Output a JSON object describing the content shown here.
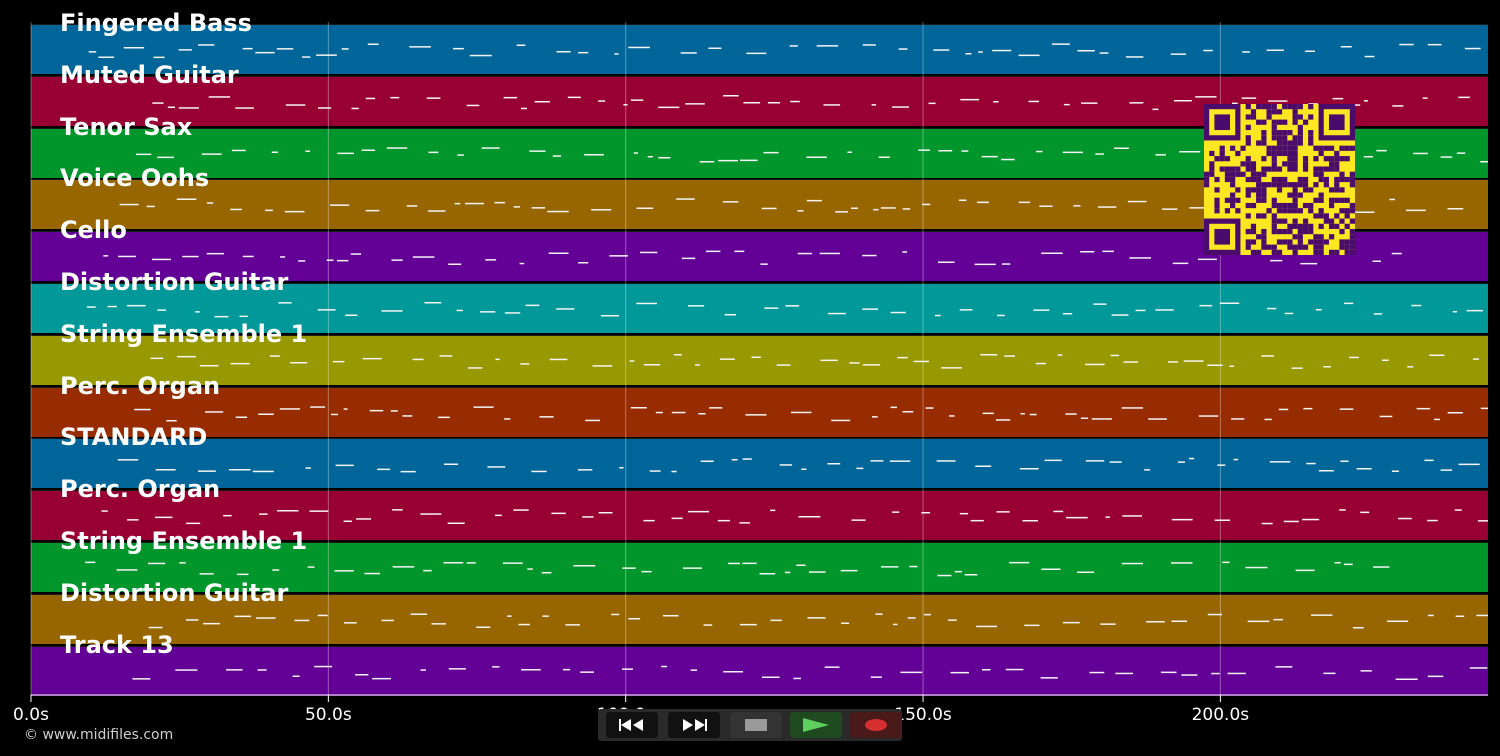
{
  "tracks": [
    {
      "name": "Fingered Bass",
      "color": "#00669a"
    },
    {
      "name": "Muted Guitar",
      "color": "#980033"
    },
    {
      "name": "Tenor Sax",
      "color": "#00962c"
    },
    {
      "name": "Voice Oohs",
      "color": "#986600"
    },
    {
      "name": "Cello",
      "color": "#630096"
    },
    {
      "name": "Distortion Guitar",
      "color": "#009898"
    },
    {
      "name": "String Ensemble 1",
      "color": "#989800"
    },
    {
      "name": "Perc. Organ",
      "color": "#962c00"
    },
    {
      "name": "STANDARD",
      "color": "#00669a"
    },
    {
      "name": "Perc. Organ",
      "color": "#980033"
    },
    {
      "name": "String Ensemble 1",
      "color": "#00962c"
    },
    {
      "name": "Distortion Guitar",
      "color": "#986600"
    },
    {
      "name": "Track 13",
      "color": "#630096"
    }
  ],
  "timeline": {
    "ticks": [
      "0.0s",
      "50.0s",
      "100.0s",
      "150.0s",
      "200.0s"
    ],
    "tick_seconds": [
      0,
      50,
      100,
      150,
      200
    ],
    "max_seconds": 245
  },
  "transport": {
    "rewind": "rewind-icon",
    "fast_forward": "fast-forward-icon",
    "stop": "stop-icon",
    "play": "play-icon",
    "record": "record-icon"
  },
  "copyright": "© www.midifiles.com"
}
